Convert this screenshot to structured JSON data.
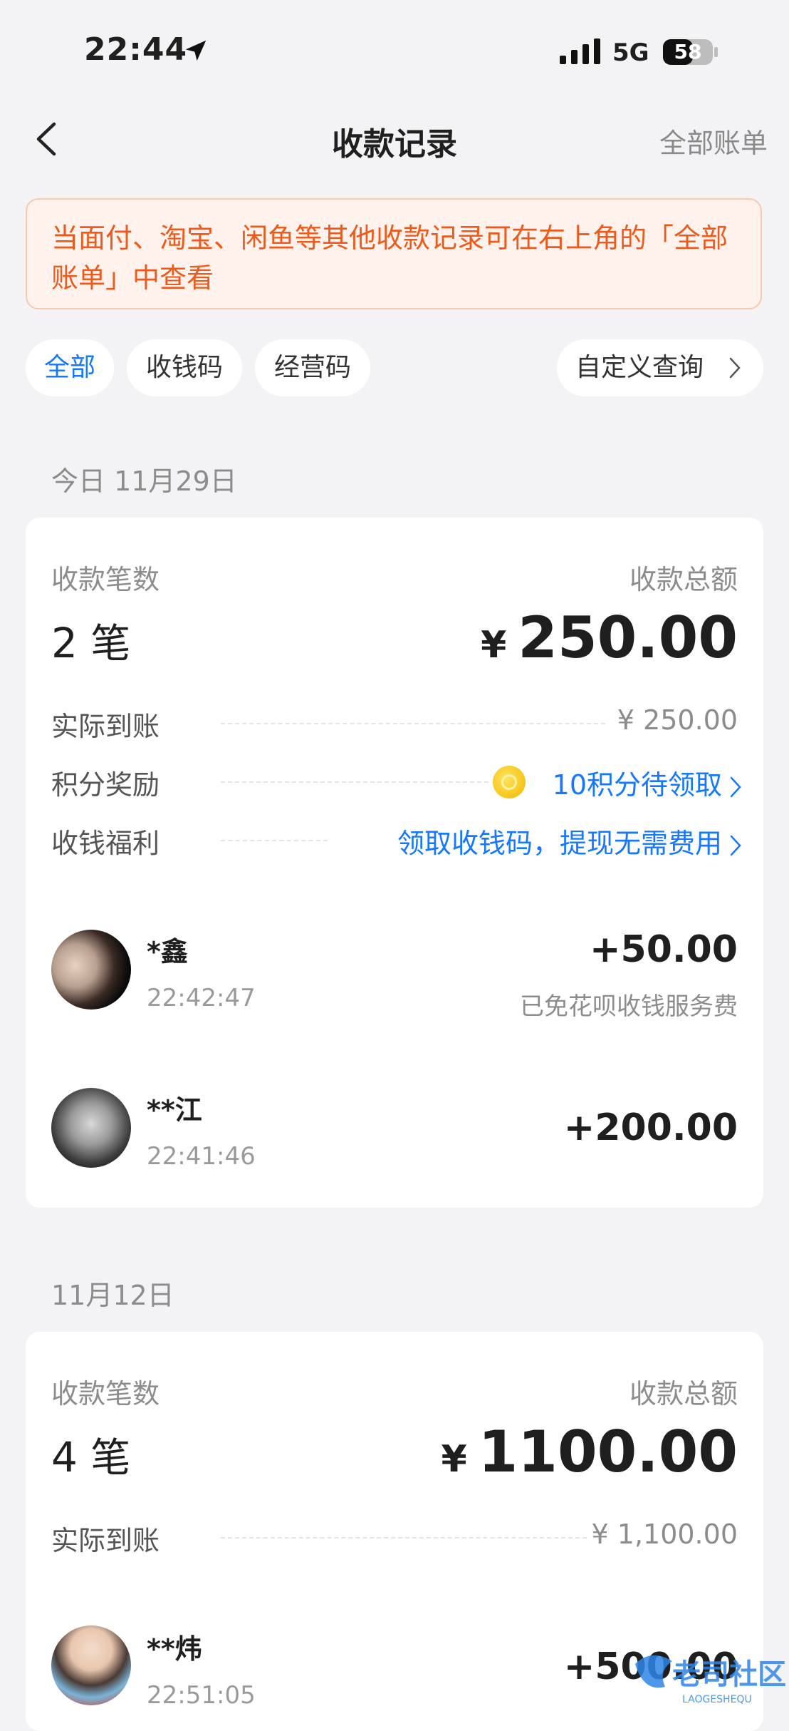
{
  "status_bar": {
    "time": "22:44",
    "network": "5G",
    "battery": "58"
  },
  "nav": {
    "title": "收款记录",
    "right_link": "全部账单"
  },
  "notice": {
    "text": "当面付、淘宝、闲鱼等其他收款记录可在右上角的「全部账单」中查看"
  },
  "filters": {
    "items": [
      "全部",
      "收钱码",
      "经营码"
    ],
    "active": "全部",
    "custom_query": "自定义查询"
  },
  "groups": [
    {
      "date": "今日 11月29日",
      "count_label": "收款笔数",
      "count": "2",
      "count_unit": "笔",
      "total_label": "收款总额",
      "total_currency": "¥",
      "total": "250.00",
      "received_label": "实际到账",
      "received": "¥ 250.00",
      "points_label": "积分奖励",
      "points": "10积分待领取",
      "benefit_label": "收钱福利",
      "benefit": "领取收钱码，提现无需费用",
      "transactions": [
        {
          "name": "*鑫",
          "time": "22:42:47",
          "amount": "+50.00",
          "note": "已免花呗收钱服务费"
        },
        {
          "name": "**江",
          "time": "22:41:46",
          "amount": "+200.00",
          "note": ""
        }
      ]
    },
    {
      "date": "11月12日",
      "count_label": "收款笔数",
      "count": "4",
      "count_unit": "笔",
      "total_label": "收款总额",
      "total_currency": "¥",
      "total": "1100.00",
      "received_label": "实际到账",
      "received": "¥ 1,100.00",
      "transactions": [
        {
          "name": "**炜",
          "time": "22:51:05",
          "amount": "+500.00",
          "note": ""
        }
      ]
    }
  ],
  "watermark": {
    "text": "老司社区",
    "subtext": "LAOGESHEQU"
  },
  "colors": {
    "accent_blue": "#1677ff",
    "notice_orange": "#ec5b1b",
    "notice_bg": "#fff1eb"
  }
}
